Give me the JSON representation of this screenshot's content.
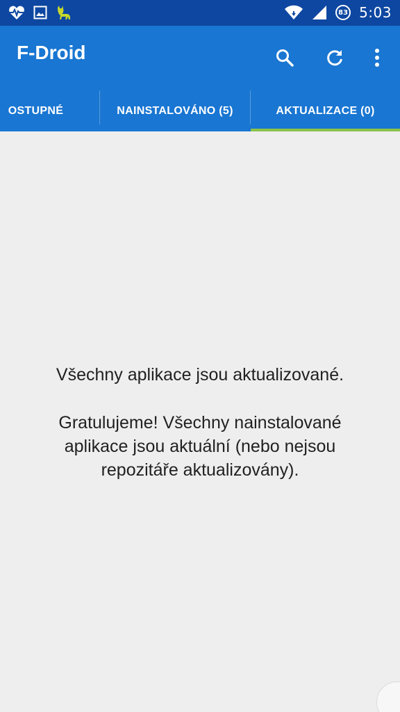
{
  "status_bar": {
    "left_icons": [
      "heart-pulse-icon",
      "image-icon",
      "android-cat-icon"
    ],
    "right_icons": [
      "wifi-icon",
      "signal-icon",
      "battery-icon"
    ],
    "battery_level": "83",
    "time": "5:03",
    "background_color": "#0d47a1"
  },
  "app_bar": {
    "title": "F-Droid",
    "actions": [
      "search-icon",
      "refresh-icon",
      "more-vert-icon"
    ],
    "background_color": "#1976d2"
  },
  "tabs": {
    "items": [
      {
        "label": "OSTUPNÉ",
        "selected": false
      },
      {
        "label": "NAINSTALOVÁNO (5)",
        "selected": false
      },
      {
        "label": "AKTUALIZACE (0)",
        "selected": true
      }
    ],
    "indicator_color": "#8bc34a"
  },
  "content": {
    "heading": "Všechny aplikace jsou aktualizované.",
    "message": "Gratulujeme! Všechny nainstalované aplikace jsou aktuální (nebo nejsou repozitáře aktualizovány)."
  }
}
